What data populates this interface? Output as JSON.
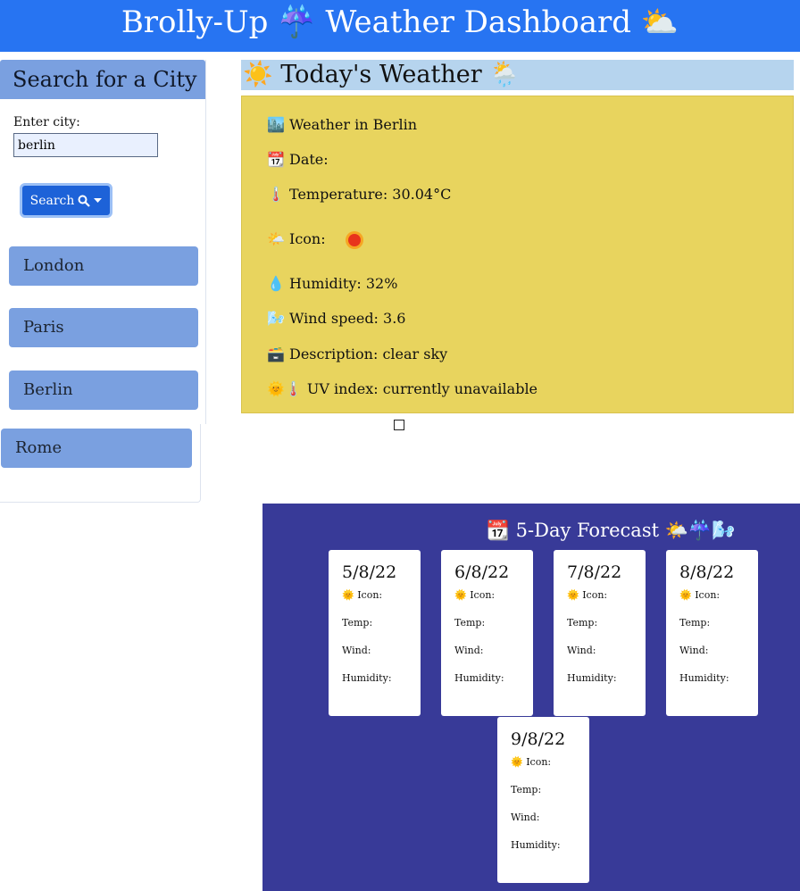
{
  "header": {
    "title": "Brolly-Up ☔ Weather Dashboard ⛅"
  },
  "sidebar": {
    "title": "Search for a City",
    "input_label": "Enter city:",
    "input_value": "berlin",
    "search_label": "Search",
    "cities": [
      "London",
      "Paris",
      "Berlin",
      "Rome"
    ]
  },
  "today": {
    "title": "☀️ Today's Weather 🌦️",
    "city": "🏙️ Weather in Berlin",
    "date": "📆 Date:",
    "temperature": "🌡️ Temperature: 30.04°C",
    "icon_label": "🌤️ Icon:",
    "humidity": "💧 Humidity: 32%",
    "wind": "🌬️ Wind speed: 3.6",
    "description": "🗃️ Description: clear sky",
    "uv": "🌞🌡️ UV index: currently unavailable"
  },
  "forecast": {
    "title": "📆 5-Day Forecast 🌤️☔🌬️",
    "icon_label": "🌞 Icon:",
    "temp_label": "Temp:",
    "wind_label": "Wind:",
    "humidity_label": "Humidity:",
    "days": [
      "5/8/22",
      "6/8/22",
      "7/8/22",
      "8/8/22",
      "9/8/22"
    ]
  }
}
